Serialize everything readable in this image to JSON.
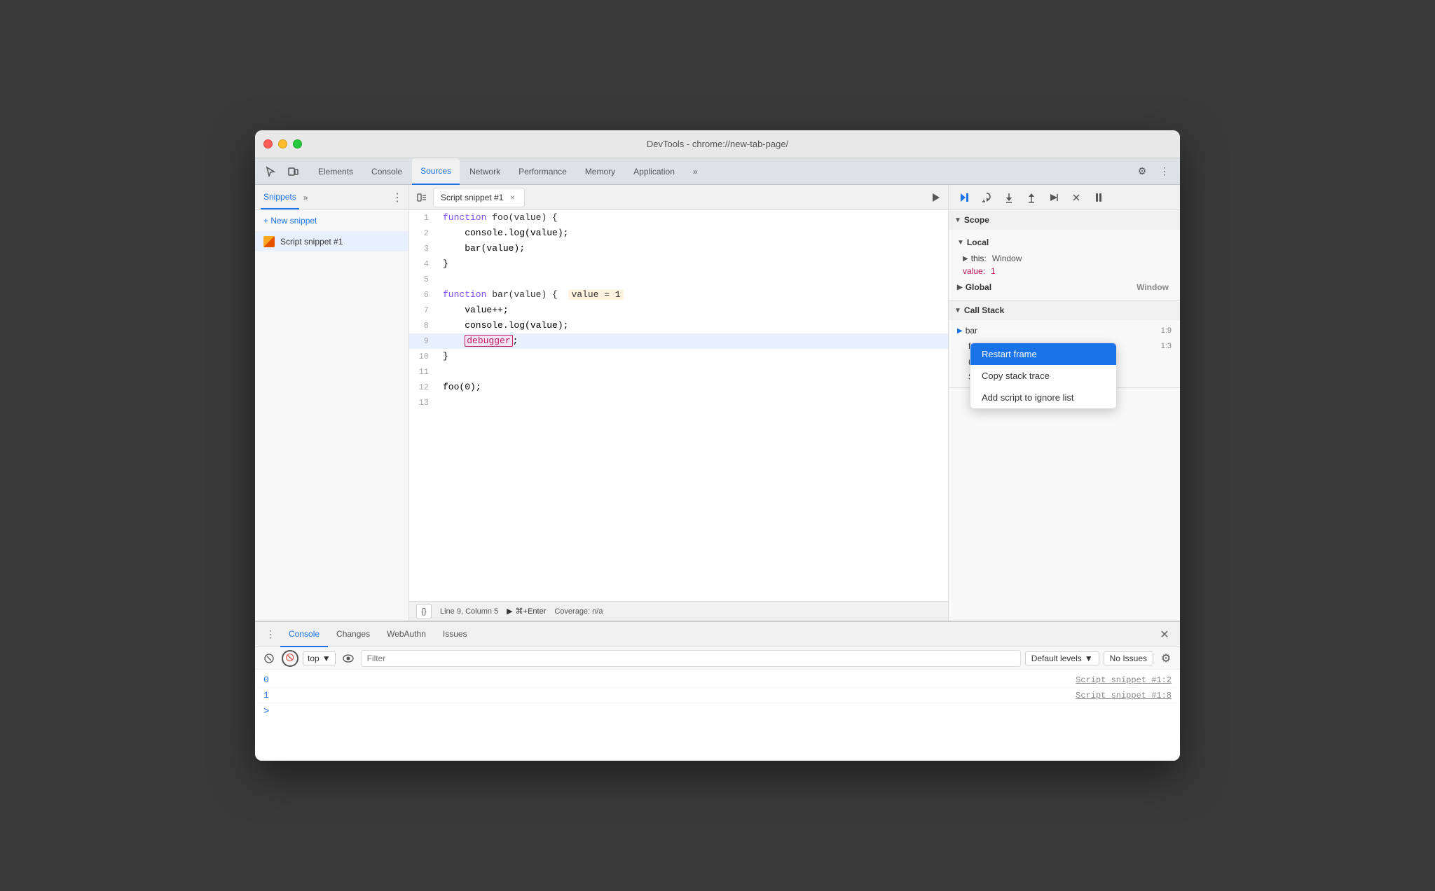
{
  "window": {
    "title": "DevTools - chrome://new-tab-page/"
  },
  "tabs": {
    "items": [
      {
        "label": "Elements",
        "active": false
      },
      {
        "label": "Console",
        "active": false
      },
      {
        "label": "Sources",
        "active": true
      },
      {
        "label": "Network",
        "active": false
      },
      {
        "label": "Performance",
        "active": false
      },
      {
        "label": "Memory",
        "active": false
      },
      {
        "label": "Application",
        "active": false
      }
    ],
    "more_label": "»"
  },
  "sidebar": {
    "tab_label": "Snippets",
    "more": "»",
    "new_snippet": "+ New snippet",
    "snippet_name": "Script snippet #1"
  },
  "code_tab": {
    "title": "Script snippet #1",
    "close": "×"
  },
  "code": {
    "lines": [
      {
        "num": "1",
        "content": "function foo(value) {"
      },
      {
        "num": "2",
        "content": "    console.log(value);"
      },
      {
        "num": "3",
        "content": "    bar(value);"
      },
      {
        "num": "4",
        "content": "}"
      },
      {
        "num": "5",
        "content": ""
      },
      {
        "num": "6",
        "content": "function bar(value) {   value = 1"
      },
      {
        "num": "7",
        "content": "    value++;"
      },
      {
        "num": "8",
        "content": "    console.log(value);"
      },
      {
        "num": "9",
        "content": "    debugger;"
      },
      {
        "num": "10",
        "content": "}"
      },
      {
        "num": "11",
        "content": ""
      },
      {
        "num": "12",
        "content": "foo(0);"
      },
      {
        "num": "13",
        "content": ""
      }
    ]
  },
  "status_bar": {
    "format": "{}",
    "position": "Line 9, Column 5",
    "run": "⌘+Enter",
    "coverage": "Coverage: n/a"
  },
  "scope": {
    "title": "Scope",
    "local_label": "Local",
    "this_label": "this:",
    "this_value": "Window",
    "value_label": "value:",
    "value_val": "1",
    "global_label": "Global",
    "global_value": "Window"
  },
  "call_stack": {
    "title": "Call Stack",
    "items": [
      {
        "name": "bar",
        "loc": "1:9"
      },
      {
        "name": "foo",
        "loc": "1:3"
      },
      {
        "name": "(anon…",
        "loc": ""
      },
      {
        "name": "Script snippet #1:12",
        "loc": ""
      }
    ]
  },
  "context_menu": {
    "items": [
      {
        "label": "Restart frame",
        "highlighted": true
      },
      {
        "label": "Copy stack trace",
        "highlighted": false
      },
      {
        "label": "Add script to ignore list",
        "highlighted": false
      }
    ]
  },
  "bottom": {
    "tabs": [
      {
        "label": "Console",
        "active": true
      },
      {
        "label": "Changes",
        "active": false
      },
      {
        "label": "WebAuthn",
        "active": false
      },
      {
        "label": "Issues",
        "active": false
      }
    ],
    "filter_placeholder": "Filter",
    "top_label": "top",
    "default_levels": "Default levels",
    "no_issues": "No Issues",
    "console_lines": [
      {
        "value": "0",
        "source": "Script snippet #1:2"
      },
      {
        "value": "1",
        "source": "Script snippet #1:8"
      }
    ],
    "prompt": ">"
  }
}
